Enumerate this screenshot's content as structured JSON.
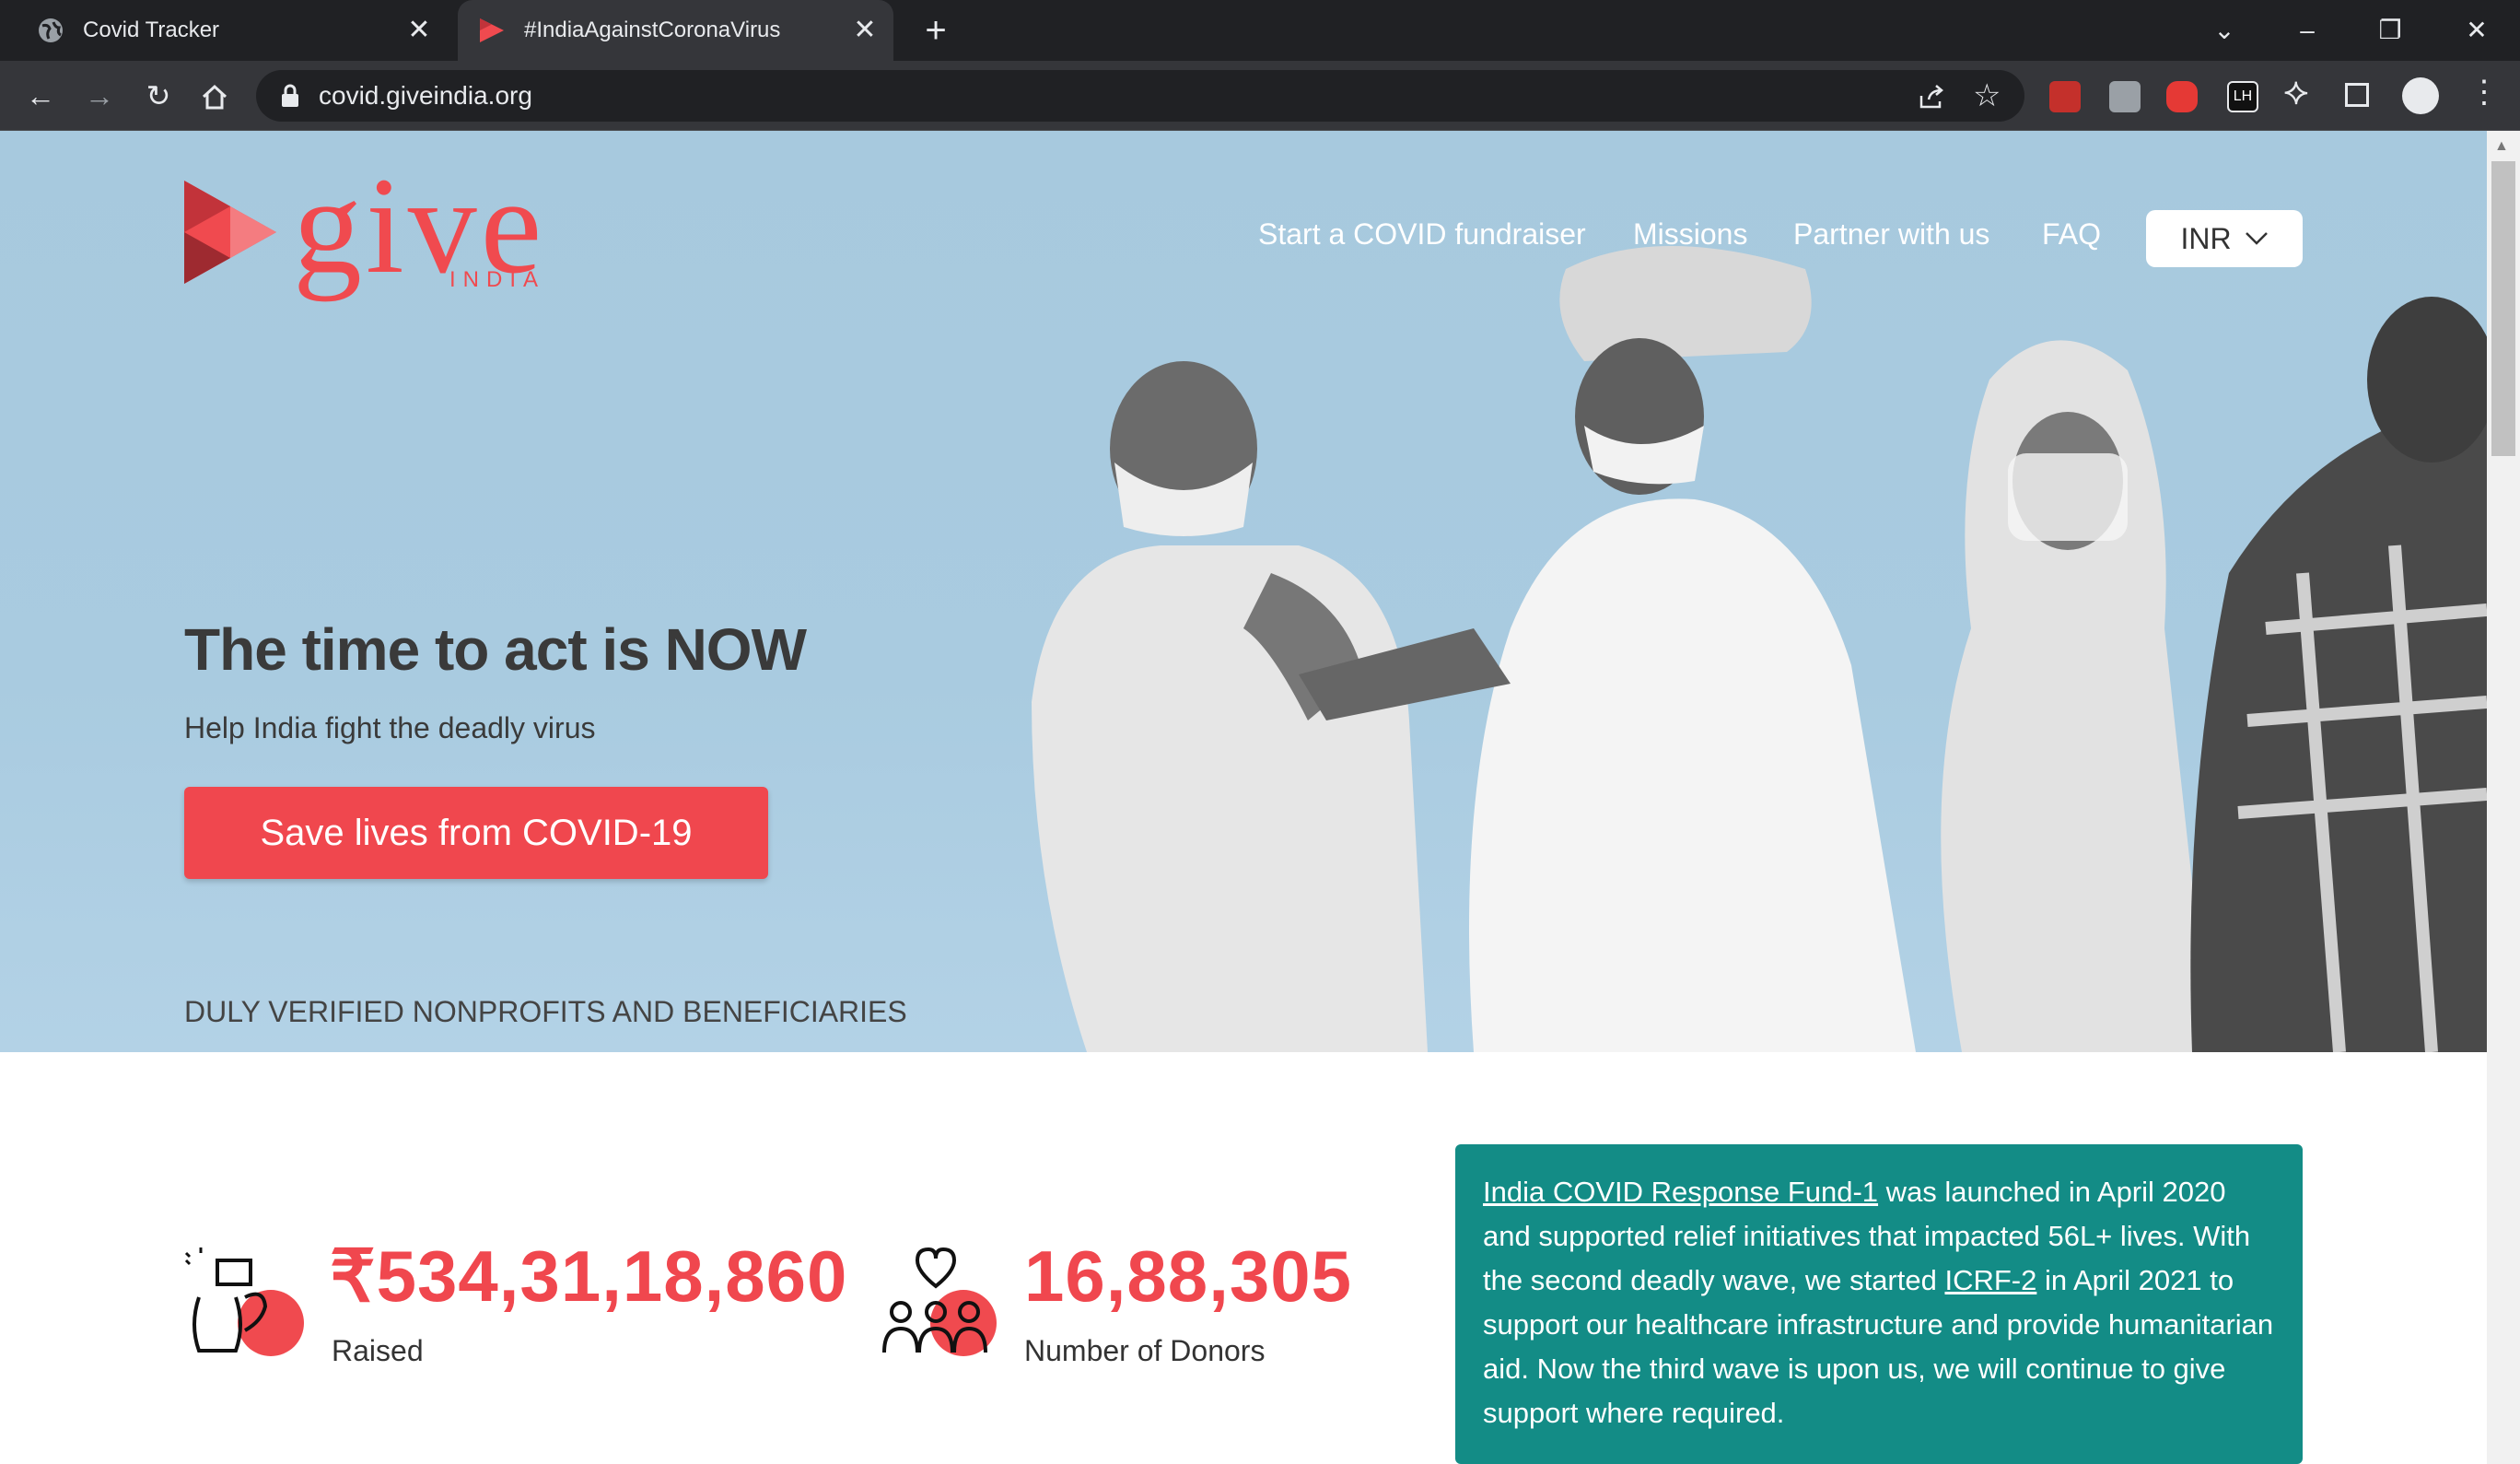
{
  "browser": {
    "tabs": [
      {
        "title": "Covid Tracker"
      },
      {
        "title": "#IndiaAgainstCoronaVirus"
      }
    ],
    "url": "covid.giveindia.org"
  },
  "site": {
    "logo": {
      "main": "give",
      "sub": "INDIA"
    },
    "nav": [
      "Start a COVID fundraiser",
      "Missions",
      "Partner with us",
      "FAQ"
    ],
    "currency": "INR"
  },
  "hero": {
    "headline": "The time to act is NOW",
    "subheadline": "Help India fight the deadly virus",
    "cta_label": "Save lives from COVID-19",
    "verified": "DULY VERIFIED NONPROFITS AND BENEFICIARIES"
  },
  "stats": {
    "raised": {
      "value": "₹534,31,18,860",
      "label": "Raised"
    },
    "donors": {
      "value": "16,88,305",
      "label": "Number of Donors"
    }
  },
  "info": {
    "link1": "India COVID Response Fund-1",
    "text1": " was launched in April 2020 and supported relief initiatives that impacted 56L+ lives. With the second deadly wave, we started ",
    "link2": "ICRF-2",
    "text2": " in April 2021 to support our healthcare infrastructure and provide humanitarian aid. Now the third wave is upon us, we will continue to give support where required."
  },
  "colors": {
    "brand": "#f04a4f",
    "teal": "#138c86",
    "hero_bg": "#a9cbe0"
  }
}
